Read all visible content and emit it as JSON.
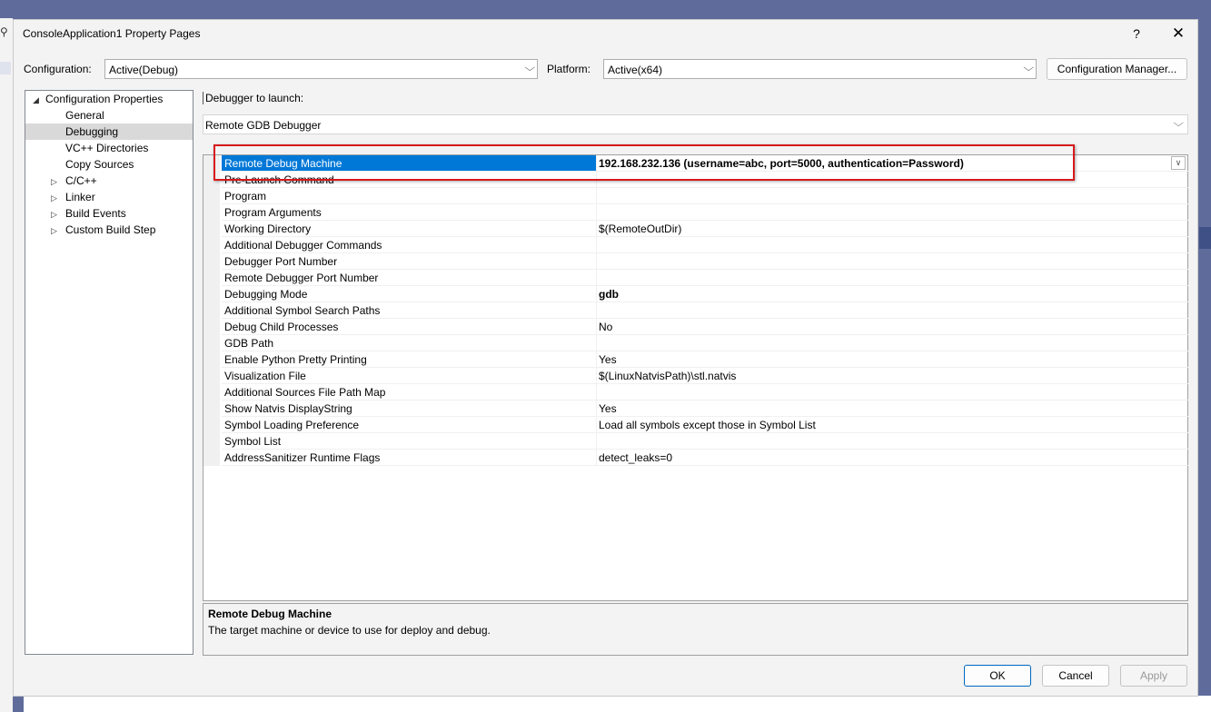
{
  "window": {
    "title": "ConsoleApplication1 Property Pages",
    "help_label": "?",
    "close_label": "✕",
    "background_search_glyph": "⚲"
  },
  "config_bar": {
    "configuration_label": "Configuration:",
    "configuration_value": "Active(Debug)",
    "platform_label": "Platform:",
    "platform_value": "Active(x64)",
    "manager_button": "Configuration Manager..."
  },
  "tree": {
    "items": [
      {
        "label": "Configuration Properties",
        "expander": "◢"
      },
      {
        "label": "General"
      },
      {
        "label": "Debugging"
      },
      {
        "label": "VC++ Directories"
      },
      {
        "label": "Copy Sources"
      },
      {
        "label": "C/C++",
        "expander": "▷"
      },
      {
        "label": "Linker",
        "expander": "▷"
      },
      {
        "label": "Build Events",
        "expander": "▷"
      },
      {
        "label": "Custom Build Step",
        "expander": "▷"
      }
    ]
  },
  "debugger": {
    "launch_label": "Debugger to launch:",
    "launch_value": "Remote GDB Debugger"
  },
  "properties": [
    {
      "name": "Remote Debug Machine",
      "value": "192.168.232.136 (username=abc, port=5000, authentication=Password)"
    },
    {
      "name": "Pre-Launch Command",
      "value": ""
    },
    {
      "name": "Program",
      "value": ""
    },
    {
      "name": "Program Arguments",
      "value": ""
    },
    {
      "name": "Working Directory",
      "value": "$(RemoteOutDir)"
    },
    {
      "name": "Additional Debugger Commands",
      "value": ""
    },
    {
      "name": "Debugger Port Number",
      "value": ""
    },
    {
      "name": "Remote Debugger Port Number",
      "value": ""
    },
    {
      "name": "Debugging Mode",
      "value": "gdb"
    },
    {
      "name": "Additional Symbol Search Paths",
      "value": ""
    },
    {
      "name": "Debug Child Processes",
      "value": "No"
    },
    {
      "name": "GDB Path",
      "value": ""
    },
    {
      "name": "Enable Python Pretty Printing",
      "value": "Yes"
    },
    {
      "name": "Visualization File",
      "value": "$(LinuxNatvisPath)\\stl.natvis"
    },
    {
      "name": "Additional Sources File Path Map",
      "value": ""
    },
    {
      "name": "Show Natvis DisplayString",
      "value": "Yes"
    },
    {
      "name": "Symbol Loading Preference",
      "value": "Load all symbols except those in Symbol List"
    },
    {
      "name": "Symbol List",
      "value": ""
    },
    {
      "name": "AddressSanitizer Runtime Flags",
      "value": "detect_leaks=0"
    }
  ],
  "description": {
    "title": "Remote Debug Machine",
    "text": "The target machine or device to use for deploy and debug."
  },
  "buttons": {
    "ok": "OK",
    "cancel": "Cancel",
    "apply": "Apply"
  },
  "colors": {
    "selection": "#0078d7",
    "highlight_box": "#d7191c"
  }
}
